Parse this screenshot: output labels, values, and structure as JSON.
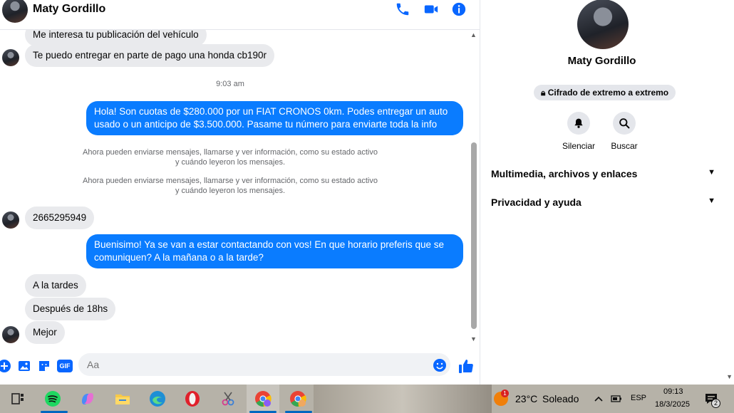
{
  "header": {
    "contact_name": "Maty Gordillo"
  },
  "messages": {
    "in_1": "Me interesa tu publicación del vehículo",
    "in_2": "Te puedo entregar en parte de pago una honda cb190r",
    "time_1": "9:03 am",
    "out_1": "Hola! Son cuotas de $280.000 por un FIAT CRONOS 0km. Podes entregar un auto usado o un anticipo de $3.500.000. Pasame tu número para enviarte toda la info",
    "sys_1_line1": "Ahora pueden enviarse mensajes, llamarse y ver información, como su estado activo",
    "sys_1_line2": "y cuándo leyeron los mensajes.",
    "sys_2_line1": "Ahora pueden enviarse mensajes, llamarse y ver información, como su estado activo",
    "sys_2_line2": "y cuándo leyeron los mensajes.",
    "in_3": "2665295949",
    "out_2": "Buenisimo! Ya se van a estar contactando con vos! En que horario preferis que se comuniquen? A la mañana o a la tarde?",
    "in_4": "A la tardes",
    "in_5": "Después de 18hs",
    "in_6": "Mejor"
  },
  "composer": {
    "placeholder": "Aa",
    "gif_label": "GIF"
  },
  "info_panel": {
    "name": "Maty Gordillo",
    "encryption": "Cifrado de extremo a extremo",
    "actions": [
      {
        "label": "Silenciar",
        "icon": "bell-icon"
      },
      {
        "label": "Buscar",
        "icon": "search-icon"
      }
    ],
    "sections": [
      {
        "label": "Multimedia, archivos y enlaces"
      },
      {
        "label": "Privacidad y ayuda"
      }
    ]
  },
  "taskbar": {
    "weather_badge": "1",
    "temperature": "23°C",
    "weather": "Soleado",
    "language": "ESP",
    "time": "09:13",
    "date": "18/3/2025",
    "notif_count": "2"
  },
  "colors": {
    "accent": "#0a7cff",
    "incoming_bubble": "#e9eaed",
    "icon_blue": "#0866ff"
  }
}
